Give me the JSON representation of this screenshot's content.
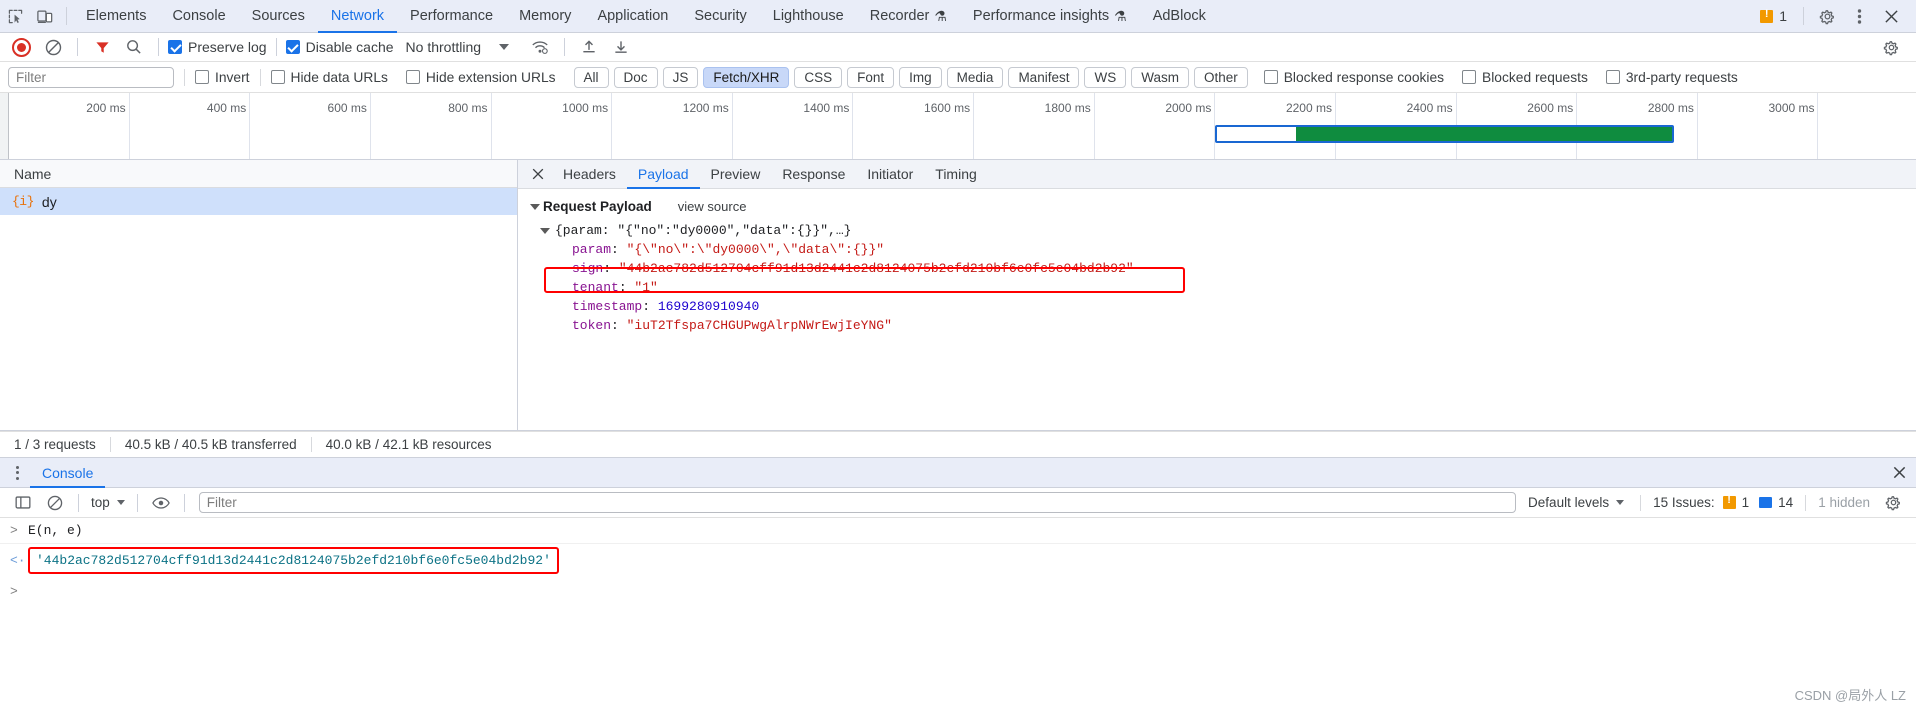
{
  "main_tabbar": {
    "icons": [
      "inspect-icon",
      "device-toolbar-icon"
    ],
    "tabs": [
      {
        "label": "Elements",
        "active": false,
        "flask": ""
      },
      {
        "label": "Console",
        "active": false,
        "flask": ""
      },
      {
        "label": "Sources",
        "active": false,
        "flask": ""
      },
      {
        "label": "Network",
        "active": true,
        "flask": ""
      },
      {
        "label": "Performance",
        "active": false,
        "flask": ""
      },
      {
        "label": "Memory",
        "active": false,
        "flask": ""
      },
      {
        "label": "Application",
        "active": false,
        "flask": ""
      },
      {
        "label": "Security",
        "active": false,
        "flask": ""
      },
      {
        "label": "Lighthouse",
        "active": false,
        "flask": ""
      },
      {
        "label": "Recorder",
        "active": false,
        "flask": "⚗"
      },
      {
        "label": "Performance insights",
        "active": false,
        "flask": "⚗"
      },
      {
        "label": "AdBlock",
        "active": false,
        "flask": ""
      }
    ],
    "issue_count": "1",
    "settings_label": "settings-icon",
    "more_label": "more-options-icon",
    "close_label": "close-icon"
  },
  "network_toolbar": {
    "record_label": "record-button",
    "clear_label": "clear-button",
    "filter_toggle_label": "filter-funnel-icon",
    "search_label": "search-icon",
    "preserve_log": "Preserve log",
    "preserve_log_checked": true,
    "disable_cache": "Disable cache",
    "disable_cache_checked": true,
    "throttling": "No throttling",
    "wifi_label": "network-conditions-icon",
    "import_label": "import-har-icon",
    "export_label": "export-har-icon",
    "settings_label": "network-settings-icon"
  },
  "filter_row": {
    "filter_placeholder": "Filter",
    "filter_value": "",
    "invert": "Invert",
    "hide_data_urls": "Hide data URLs",
    "hide_extension_urls": "Hide extension URLs",
    "types": [
      {
        "label": "All",
        "active": false
      },
      {
        "label": "Doc",
        "active": false
      },
      {
        "label": "JS",
        "active": false
      },
      {
        "label": "Fetch/XHR",
        "active": true
      },
      {
        "label": "CSS",
        "active": false
      },
      {
        "label": "Font",
        "active": false
      },
      {
        "label": "Img",
        "active": false
      },
      {
        "label": "Media",
        "active": false
      },
      {
        "label": "Manifest",
        "active": false
      },
      {
        "label": "WS",
        "active": false
      },
      {
        "label": "Wasm",
        "active": false
      },
      {
        "label": "Other",
        "active": false
      }
    ],
    "blocked_response_cookies": "Blocked response cookies",
    "blocked_requests": "Blocked requests",
    "third_party_requests": "3rd-party requests"
  },
  "overview": {
    "ticks": [
      "200 ms",
      "400 ms",
      "600 ms",
      "800 ms",
      "1000 ms",
      "1200 ms",
      "1400 ms",
      "1600 ms",
      "1800 ms",
      "2000 ms",
      "2400 ms",
      "2600 ms",
      "2800 ms",
      "3000 ms"
    ],
    "all_ticks": [
      "200 ms",
      "400 ms",
      "600 ms",
      "800 ms",
      "1000 ms",
      "1200 ms",
      "1400 ms",
      "1600 ms",
      "1800 ms",
      "2000 ms",
      "2200 ms",
      "2400 ms",
      "2600 ms",
      "2800 ms",
      "3000 ms"
    ],
    "bar_start_ms": 2000,
    "bar_end_ms": 2760,
    "bar_wait_end_ms": 2130,
    "bar_fill_color": "#0f8c3f",
    "bar_outline_color": "#1967d2",
    "axis_max_ms": 3160
  },
  "requests_pane": {
    "column_header": "Name",
    "rows": [
      {
        "icon": "json-icon",
        "name": "dy",
        "selected": true
      }
    ]
  },
  "detail_pane": {
    "close_label": "close-detail-icon",
    "tabs": [
      {
        "label": "Headers",
        "active": false
      },
      {
        "label": "Payload",
        "active": true
      },
      {
        "label": "Preview",
        "active": false
      },
      {
        "label": "Response",
        "active": false
      },
      {
        "label": "Initiator",
        "active": false
      },
      {
        "label": "Timing",
        "active": false
      }
    ],
    "payload": {
      "section_title": "Request Payload",
      "view_source": "view source",
      "root_line": "{param: \"{\"no\":\"dy0000\",\"data\":{}}\",…}",
      "root_prefix": "{param: ",
      "root_value": "\"{\"no\":\"dy0000\",\"data\":{}}\"",
      "root_suffix": ",…}",
      "entries": [
        {
          "key": "param",
          "value": "\"{\\\"no\\\":\\\"dy0000\\\",\\\"data\\\":{}}\"",
          "type": "string",
          "highlighted": false
        },
        {
          "key": "sign",
          "value": "\"44b2ac782d512704cff91d13d2441c2d8124075b2efd210bf6e0fc5e04bd2b92\"",
          "type": "string",
          "highlighted": true
        },
        {
          "key": "tenant",
          "value": "\"1\"",
          "type": "string",
          "highlighted": false
        },
        {
          "key": "timestamp",
          "value": "1699280910940",
          "type": "number",
          "highlighted": false
        },
        {
          "key": "token",
          "value": "\"iuT2Tfspa7CHGUPwgAlrpNWrEwjIeYNG\"",
          "type": "string",
          "highlighted": false
        }
      ]
    }
  },
  "status_bar": {
    "requests": "1 / 3 requests",
    "transferred": "40.5 kB / 40.5 kB transferred",
    "resources": "40.0 kB / 42.1 kB resources"
  },
  "drawer": {
    "more_label": "drawer-more-icon",
    "tab_label": "Console",
    "close_label": "close-drawer-icon",
    "toolbar": {
      "sidebar_label": "console-sidebar-icon",
      "clear_label": "clear-console-icon",
      "context": "top",
      "eye_label": "live-expression-icon",
      "filter_placeholder": "Filter",
      "filter_value": "",
      "levels": "Default levels",
      "issues_label": "15 Issues:",
      "issues_warning_count": "1",
      "issues_info_count": "14",
      "hidden": "1 hidden",
      "settings_label": "console-settings-icon"
    },
    "entries": [
      {
        "kind": "input",
        "arrow": ">",
        "text": "E(n, e)",
        "highlighted": false
      },
      {
        "kind": "output",
        "arrow": "<·",
        "text": "'44b2ac782d512704cff91d13d2441c2d8124075b2efd210bf6e0fc5e04bd2b92'",
        "highlighted": true
      },
      {
        "kind": "prompt",
        "arrow": ">",
        "text": "",
        "highlighted": false
      }
    ]
  },
  "watermark": "CSDN @局外人 LZ",
  "colors": {
    "accent": "#1a73e8",
    "chip_active_bg": "#c8d8f8",
    "highlight": "#ff0000",
    "record": "#d93025",
    "bar_green": "#0f8c3f",
    "toolbar_bg": "#e9edf8"
  }
}
